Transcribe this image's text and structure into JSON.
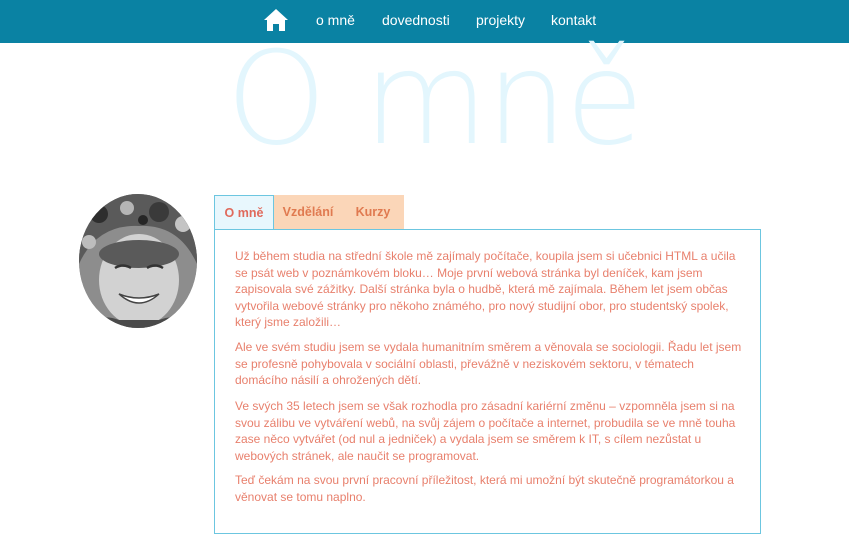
{
  "nav": {
    "home_icon": "home-icon",
    "items": [
      {
        "label": "o mně"
      },
      {
        "label": "dovednosti"
      },
      {
        "label": "projekty"
      },
      {
        "label": "kontakt"
      }
    ]
  },
  "hero": {
    "title": "O mně"
  },
  "tabs": [
    {
      "label": "O mně",
      "active": true
    },
    {
      "label": "Vzdělání",
      "active": false
    },
    {
      "label": "Kurzy",
      "active": false
    }
  ],
  "content": {
    "paragraphs": [
      "Už během studia na střední škole mě zajímaly počítače, koupila jsem si učebnici HTML a učila se psát web v poznámkovém bloku… Moje první webová stránka byl deníček, kam jsem zapisovala své zážitky. Další stránka byla o hudbě, která mě zajímala. Během let jsem občas vytvořila webové stránky pro někoho známého, pro nový studijní obor, pro studentský spolek, který jsme založili…",
      "Ale ve svém studiu jsem se vydala humanitním směrem a věnovala se sociologii. Řadu let jsem se profesně pohybovala v sociální oblasti, převážně v neziskovém sektoru, v tématech domácího násilí a ohrožených dětí.",
      "Ve svých 35 letech jsem se však rozhodla pro zásadní kariérní změnu – vzpomněla jsem si na svou zálibu ve vytváření webů, na svůj zájem o počítače a internet, probudila se ve mně touha zase něco vytvářet (od nul a jedniček) a vydala jsem se směrem k IT, s cílem nezůstat u webových stránek, ale naučit se programovat.",
      "Teď čekám na svou první pracovní příležitost, která mi umožní být skutečně programátorkou a věnovat se tomu naplno."
    ]
  },
  "colors": {
    "nav_bg": "#0a82a3",
    "hero_text": "#e3f6fd",
    "accent_text": "#e8806d",
    "tab_border": "#6cc6e0",
    "tab_inactive_bg": "#fbd6b8"
  }
}
